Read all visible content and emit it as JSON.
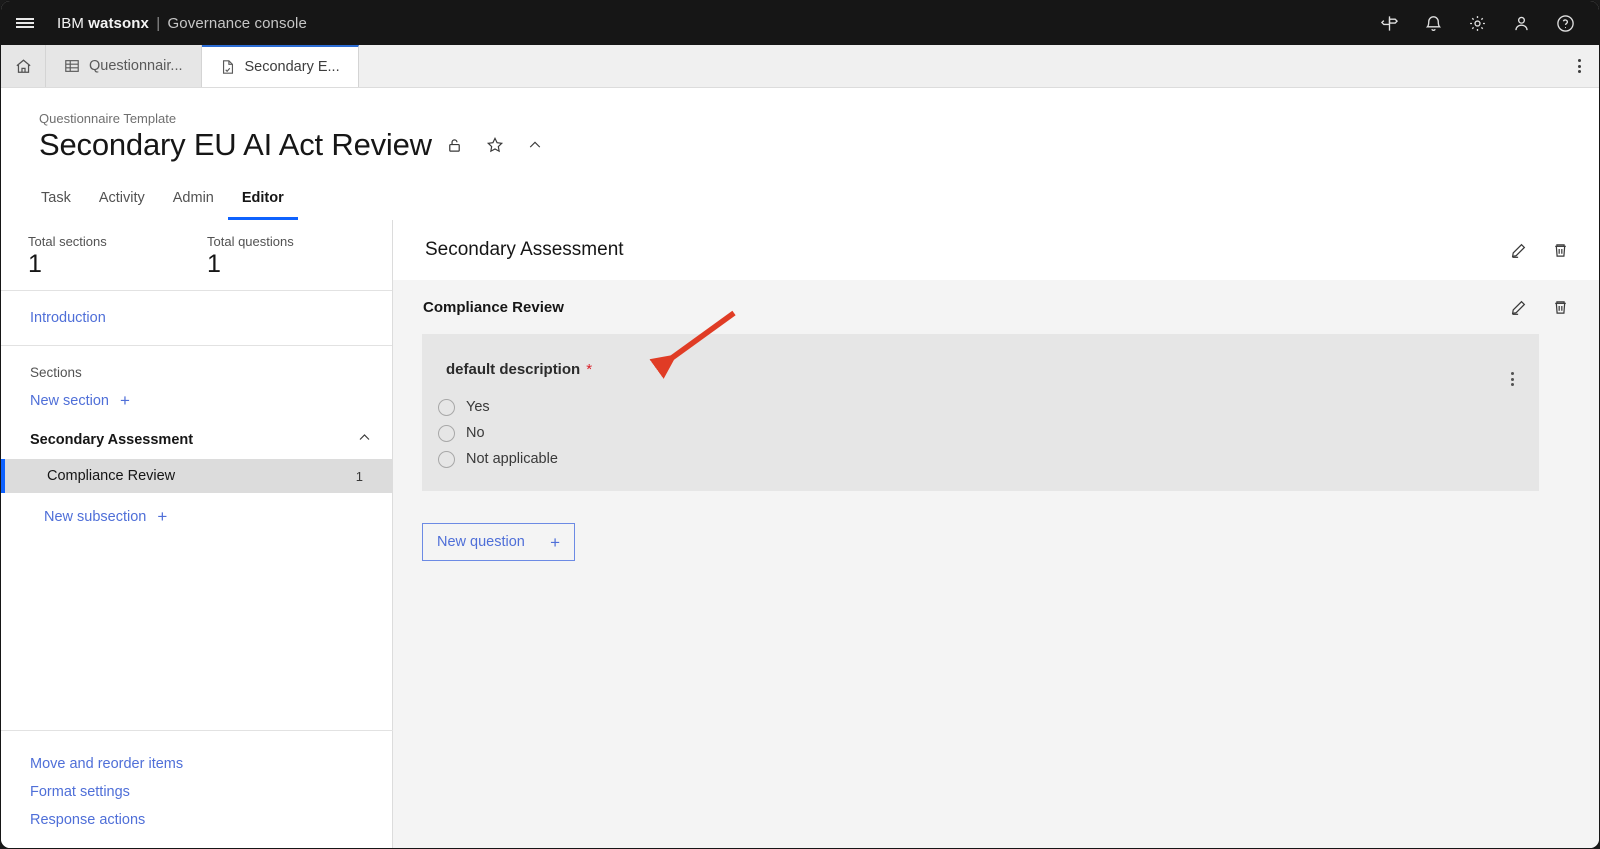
{
  "topbar": {
    "menu_icon": "hamburger-icon",
    "brand_prefix": "IBM",
    "brand_name": "watsonx",
    "brand_separator": "|",
    "brand_suffix": "Governance console",
    "actions": [
      {
        "name": "signpost-icon",
        "label": "Signpost"
      },
      {
        "name": "notifications-bell-icon",
        "label": "Notifications"
      },
      {
        "name": "gear-icon",
        "label": "Settings"
      },
      {
        "name": "user-icon",
        "label": "Profile"
      },
      {
        "name": "help-icon",
        "label": "Help"
      }
    ]
  },
  "tabstrip": {
    "home_icon": "home-icon",
    "tabs": [
      {
        "label": "Questionnair...",
        "icon": "table-icon",
        "active": false
      },
      {
        "label": "Secondary E...",
        "icon": "document-check-icon",
        "active": true
      }
    ],
    "overflow_icon": "kebab-menu-icon"
  },
  "header": {
    "eyebrow": "Questionnaire Template",
    "title": "Secondary EU AI Act Review",
    "lock_icon": "unlocked-padlock-icon",
    "favorite_icon": "star-icon",
    "collapse_icon": "chevron-up-icon",
    "nav_tabs": [
      {
        "label": "Task",
        "active": false
      },
      {
        "label": "Activity",
        "active": false
      },
      {
        "label": "Admin",
        "active": false
      },
      {
        "label": "Editor",
        "active": true
      }
    ]
  },
  "sidebar": {
    "stats": [
      {
        "label": "Total sections",
        "value": "1"
      },
      {
        "label": "Total questions",
        "value": "1"
      }
    ],
    "introduction_label": "Introduction",
    "sections_label": "Sections",
    "new_section_label": "New section",
    "section_group": {
      "name": "Secondary Assessment",
      "collapse_icon": "chevron-up-icon",
      "subsections": [
        {
          "name": "Compliance Review",
          "count": "1",
          "selected": true
        }
      ]
    },
    "new_subsection_label": "New subsection",
    "bottom_links": [
      {
        "label": "Move and reorder items"
      },
      {
        "label": "Format settings"
      },
      {
        "label": "Response actions"
      }
    ]
  },
  "main": {
    "section_title": "Secondary Assessment",
    "section_edit_icon": "edit-pencil-icon",
    "section_delete_icon": "trash-icon",
    "subsection_title": "Compliance Review",
    "subsection_edit_icon": "edit-pencil-icon",
    "subsection_delete_icon": "trash-icon",
    "question": {
      "label": "default description",
      "required_marker": "*",
      "overflow_icon": "kebab-menu-icon",
      "options": [
        {
          "label": "Yes",
          "selected": false
        },
        {
          "label": "No",
          "selected": false
        },
        {
          "label": "Not applicable",
          "selected": false
        }
      ]
    },
    "new_question_label": "New question",
    "new_question_plus": "+"
  },
  "annotation": {
    "type": "arrow",
    "color": "#e03c25",
    "points_at": "default description"
  },
  "colors": {
    "accent_blue": "#0f62fe",
    "link_blue": "#4f6fd8",
    "required_red": "#da1e28",
    "topbar_bg": "#161616",
    "panel_bg": "#f4f4f4",
    "card_bg": "#e6e6e6"
  }
}
